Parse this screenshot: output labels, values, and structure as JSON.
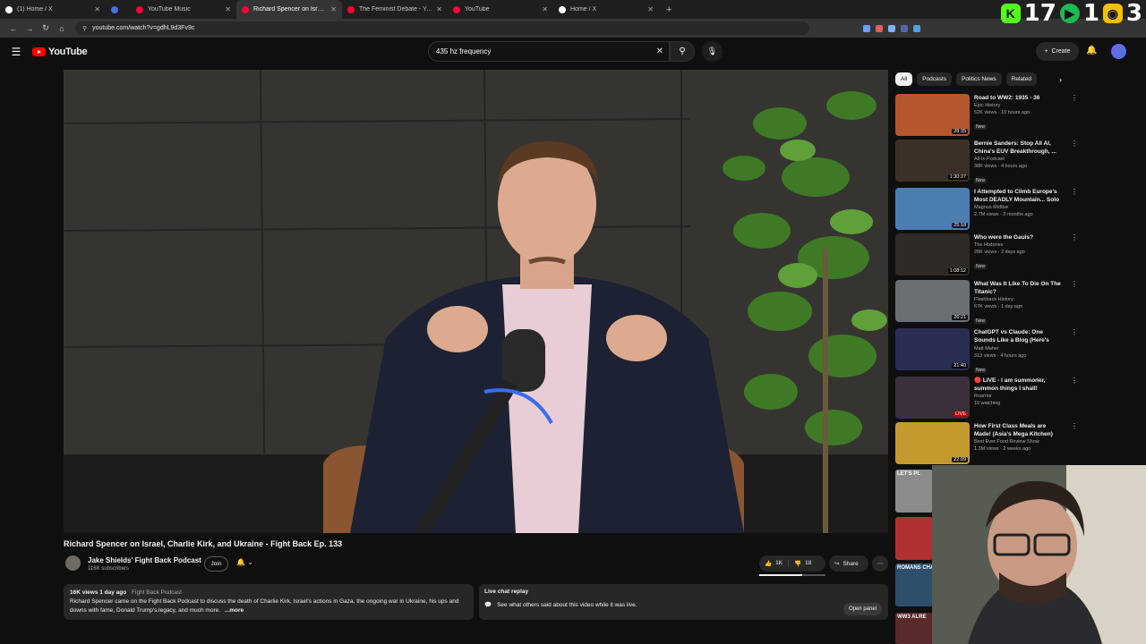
{
  "browser": {
    "tabs": [
      {
        "label": "(1) Home / X",
        "color": "#ffffff"
      },
      {
        "label": "",
        "color": "#4a6ee0"
      },
      {
        "label": "YouTube Music",
        "color": "#ff0033"
      },
      {
        "label": "Richard Spencer on Israel, C",
        "color": "#ff0033"
      },
      {
        "label": "The Feminist Debate - YouTube",
        "color": "#ff0033"
      },
      {
        "label": "YouTube",
        "color": "#ff0033"
      },
      {
        "label": "Home / X",
        "color": "#ffffff"
      }
    ],
    "url": "youtube.com/watch?v=gdhL9d3Fv9c"
  },
  "overlay": {
    "count_a": "17",
    "count_b": "1",
    "count_c": "3"
  },
  "youtube": {
    "logo": "YouTube",
    "search_value": "435 hz frequency",
    "create_label": "Create"
  },
  "video": {
    "title": "Richard Spencer on Israel, Charlie Kirk, and Ukraine - Fight Back Ep. 133",
    "channel": "Jake Shields' Fight Back Podcast",
    "subscribers": "116K subscribers",
    "join_label": "Join",
    "likes": "1K",
    "dislikes": "18",
    "share_label": "Share",
    "like_ratio": 0.65,
    "description": {
      "stats": "16K views  1 day ago",
      "tag": "Fight Back Podcast",
      "text": "Richard Spencer came on the Fight Back Podcast to discuss the death of Charlie Kirk, Israel's actions in Gaza, the ongoing war in Ukraine, his ups and downs with fame, Donald Trump's legacy, and much more.",
      "more": "...more"
    },
    "chat": {
      "title": "Live chat replay",
      "text": "See what others said about this video while it was live.",
      "open_label": "Open panel"
    }
  },
  "sidebar": {
    "chips": [
      "All",
      "Podcasts",
      "Politics News",
      "Related"
    ],
    "recommendations": [
      {
        "title": "Road to WW2: 1935 - 36",
        "channel": "Epic History",
        "meta": "52K views · 10 hours ago",
        "badge": "New",
        "duration": "28:35",
        "thumb": "#b5572d"
      },
      {
        "title": "Bernie Sanders: Stop All AI, China's EUV Breakthrough, ...",
        "channel": "All-In Podcast",
        "meta": "38K views · 4 hours ago",
        "badge": "New",
        "duration": "1:30:27",
        "thumb": "#3b3027"
      },
      {
        "title": "I Attempted to Climb Europe's Most DEADLY Mountain... Solo",
        "channel": "Magnus Midtbø",
        "meta": "2.7M views · 2 months ago",
        "badge": "",
        "duration": "25:18",
        "thumb": "#4b7db3"
      },
      {
        "title": "Who were the Gauls?",
        "channel": "The Histories",
        "meta": "28K views · 2 days ago",
        "badge": "New",
        "duration": "1:08:12",
        "thumb": "#2f2a26"
      },
      {
        "title": "What Was It Like To Die On The Titanic?",
        "channel": "Flashback History",
        "meta": "67K views · 1 day ago",
        "badge": "New",
        "duration": "26:21",
        "thumb": "#6b6f74"
      },
      {
        "title": "ChatGPT vs Claude: One Sounds Like a Blog (Here's the...",
        "channel": "Matt Maher",
        "meta": "313 views · 4 hours ago",
        "badge": "New",
        "duration": "21:40",
        "thumb": "#2a2d52"
      },
      {
        "title": "🔴 LIVE - I am summoner, summon things I shall!",
        "channel": "Roarrior",
        "meta": "19 watching",
        "badge": "",
        "duration": "LIVE",
        "thumb": "#3a2f3a"
      },
      {
        "title": "How First Class Meals are Made! (Asia's Mega Kitchen)",
        "channel": "Best Ever Food Review Show",
        "meta": "1.3M views · 2 weeks ago",
        "badge": "",
        "duration": "22:09",
        "thumb": "#c49a2f"
      }
    ],
    "partials": [
      {
        "label": "LET'S PL",
        "color": "#8b8b8b"
      },
      {
        "label": "",
        "color": "#b03030"
      },
      {
        "label": "ROMANS CHANG",
        "color": "#2e4f6b"
      },
      {
        "label": "WW3 ALRE",
        "color": "#5a2a2a"
      }
    ]
  }
}
